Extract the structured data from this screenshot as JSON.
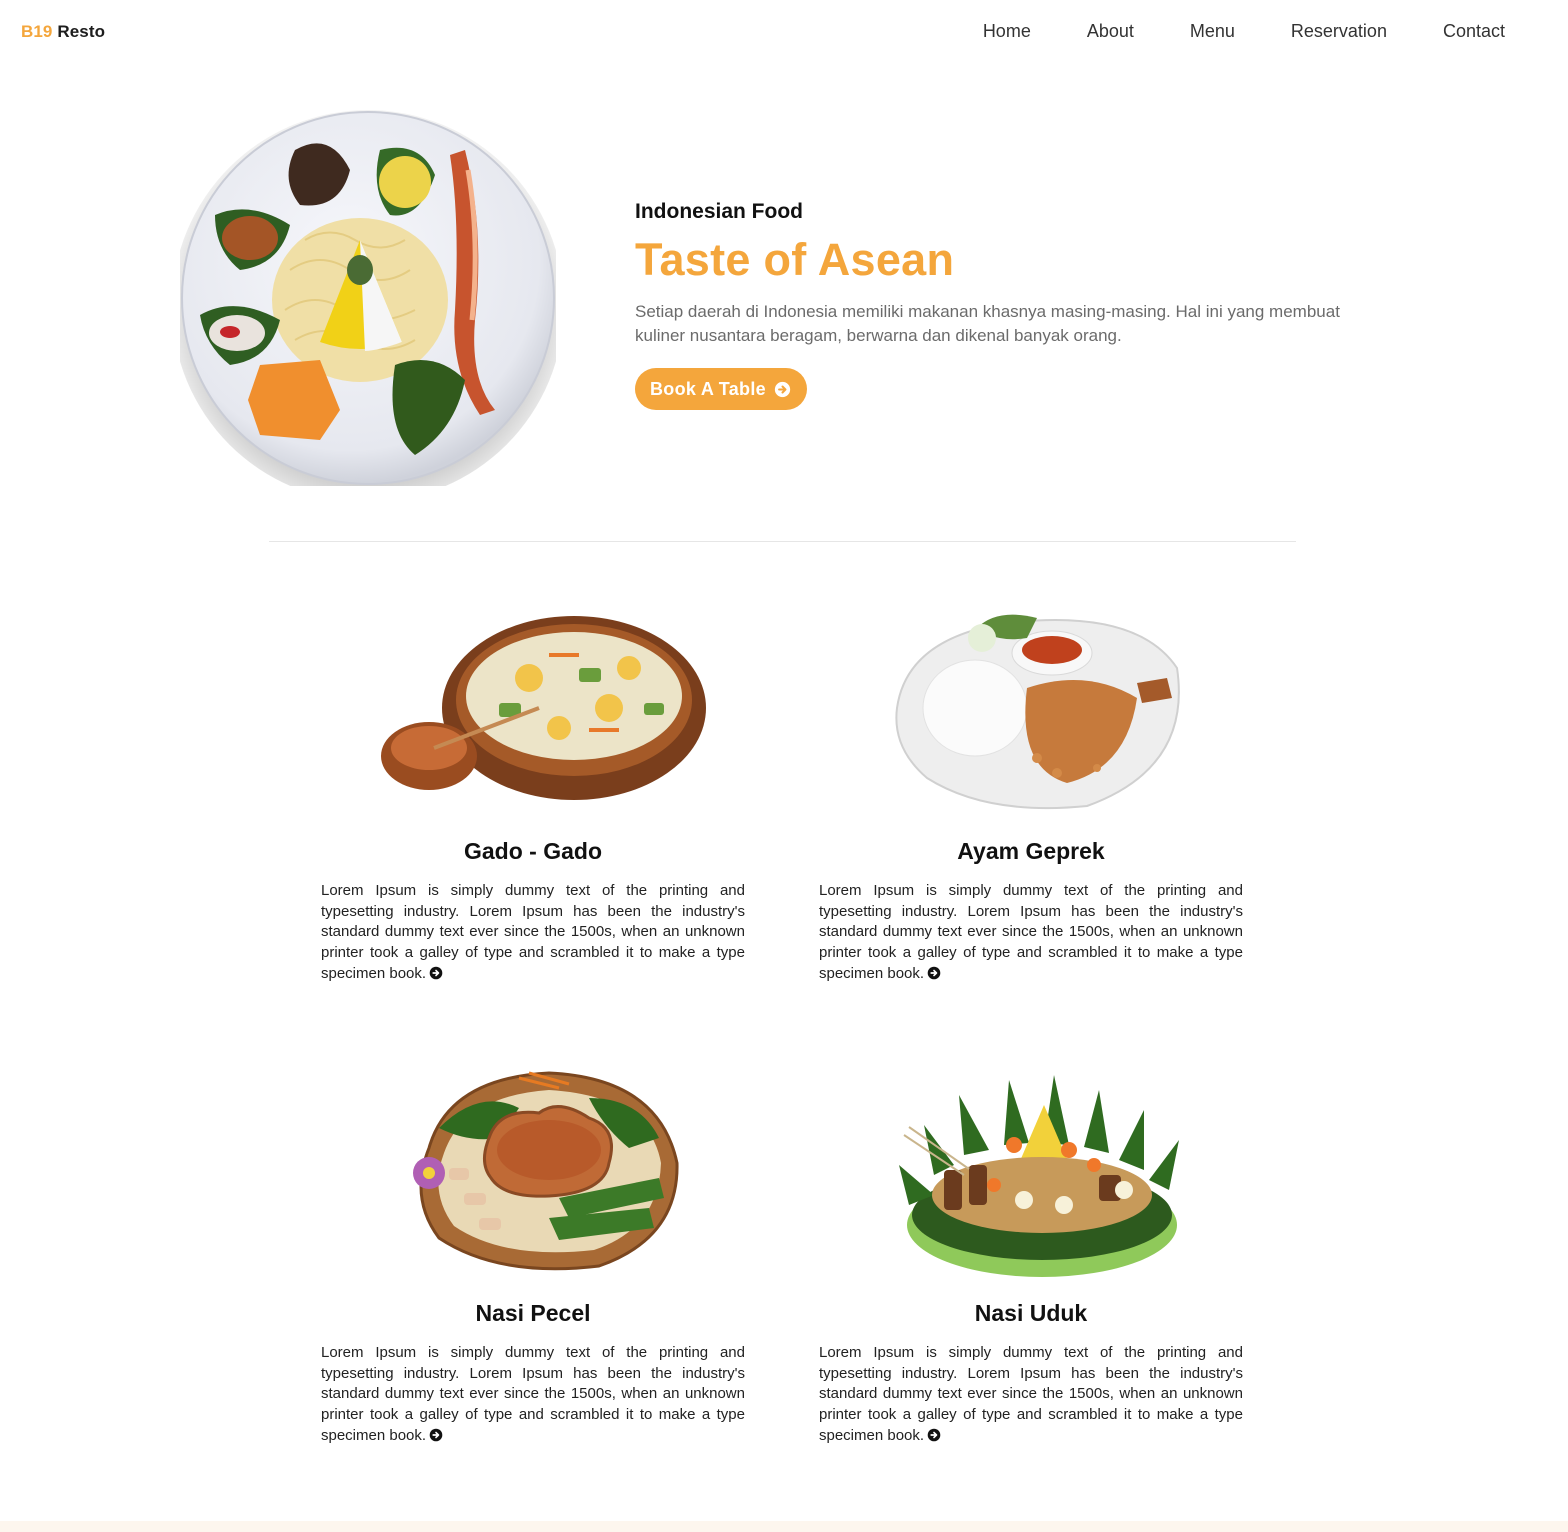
{
  "nav": {
    "brand_accent": "B19",
    "brand_rest": "Resto",
    "links": [
      "Home",
      "About",
      "Menu",
      "Reservation",
      "Contact"
    ]
  },
  "hero": {
    "subtitle": "Indonesian Food",
    "title": "Taste of Asean",
    "description": "Setiap daerah di Indonesia memiliki makanan khasnya masing-masing. Hal ini yang membuat kuliner nusantara beragam, berwarna dan dikenal banyak orang.",
    "button_label": "Book A Table",
    "button_icon": "arrow-circle-right-icon"
  },
  "menu": {
    "items": [
      {
        "name": "Gado - Gado",
        "image": "gado-gado-image",
        "description": "Lorem Ipsum is simply dummy text of the printing and typesetting industry. Lorem Ipsum has been the industry's standard dummy text ever since the 1500s, when an unknown printer took a galley of type and scrambled it to make a type specimen book."
      },
      {
        "name": "Ayam Geprek",
        "image": "ayam-geprek-image",
        "description": "Lorem Ipsum is simply dummy text of the printing and typesetting industry. Lorem Ipsum has been the industry's standard dummy text ever since the 1500s, when an unknown printer took a galley of type and scrambled it to make a type specimen book."
      },
      {
        "name": "Nasi Pecel",
        "image": "nasi-pecel-image",
        "description": "Lorem Ipsum is simply dummy text of the printing and typesetting industry. Lorem Ipsum has been the industry's standard dummy text ever since the 1500s, when an unknown printer took a galley of type and scrambled it to make a type specimen book."
      },
      {
        "name": "Nasi Uduk",
        "image": "nasi-uduk-image",
        "description": "Lorem Ipsum is simply dummy text of the printing and typesetting industry. Lorem Ipsum has been the industry's standard dummy text ever since the 1500s, when an unknown printer took a galley of type and scrambled it to make a type specimen book."
      }
    ]
  },
  "colors": {
    "accent": "#f4a63c",
    "text_dark": "#111111",
    "text_muted": "#6b6b6b"
  }
}
